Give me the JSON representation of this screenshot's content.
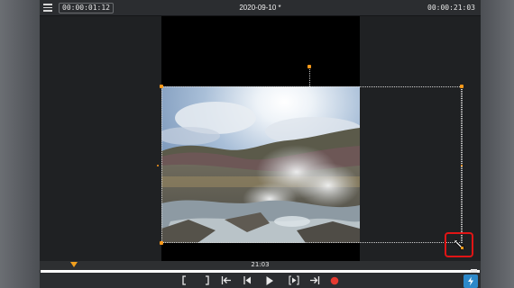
{
  "header": {
    "current_timecode": "00:00:01:12",
    "project_title": "2020-09-10 *",
    "total_timecode": "00:00:21:03"
  },
  "timeline": {
    "marker_time": "21:03"
  },
  "colors": {
    "handle": "#ff9a1a",
    "highlight": "#e01515",
    "playhead": "#f2a01e",
    "accent": "#2c88c9",
    "record": "#e5392f"
  },
  "transport": {
    "buttons": [
      "mark-in",
      "mark-out",
      "go-to-start",
      "previous-frame",
      "play",
      "next-frame",
      "go-to-end",
      "record"
    ]
  },
  "icons": [
    "menu-icon",
    "resize-cursor-icon",
    "lightning-icon"
  ]
}
